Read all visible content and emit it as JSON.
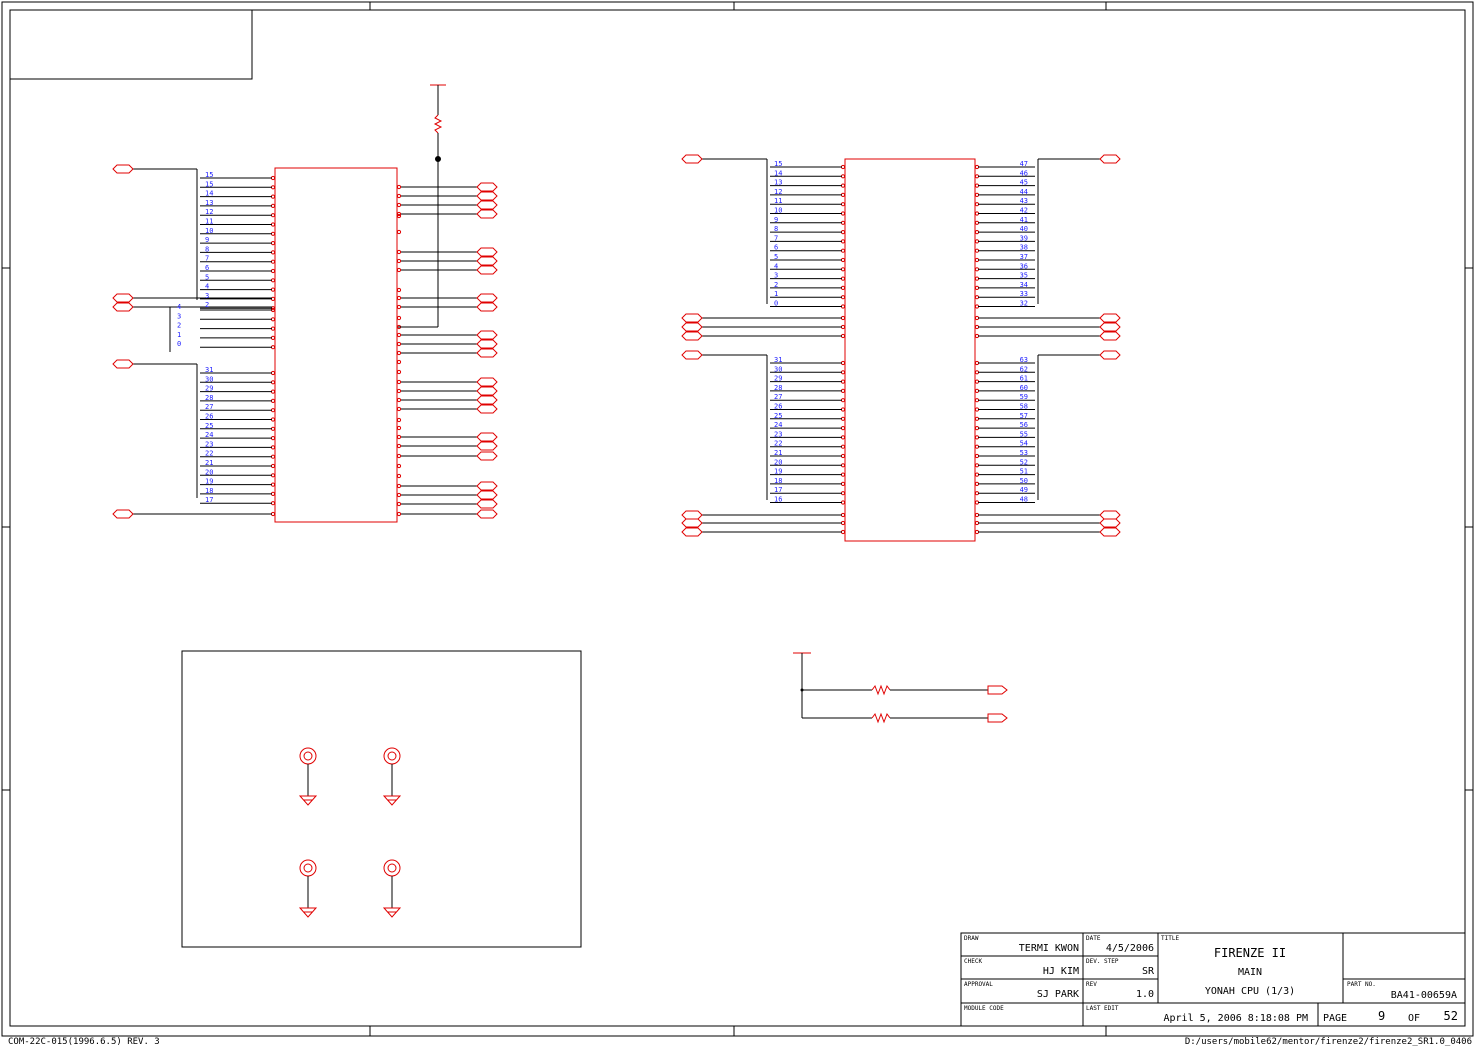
{
  "title_block": {
    "draw_label": "DRAW",
    "draw_value": "TERMI KWON",
    "check_label": "CHECK",
    "check_value": "HJ KIM",
    "approval_label": "APPROVAL",
    "approval_value": "SJ PARK",
    "module_label": "MODULE CODE",
    "date_label": "DATE",
    "date_value": "4/5/2006",
    "devstep_label": "DEV. STEP",
    "devstep_value": "SR",
    "rev_label": "REV",
    "rev_value": "1.0",
    "lastedit_label": "LAST EDIT",
    "lastedit_value": "April 5, 2006  8:18:08 PM",
    "title_label": "TITLE",
    "title_line1": "FIRENZE II",
    "title_line2": "MAIN",
    "title_line3": "YONAH CPU (1/3)",
    "partno_label": "PART NO.",
    "partno_value": "BA41-00659A",
    "page_label": "PAGE",
    "page_value": "9",
    "of_label": "OF",
    "page_total": "52"
  },
  "footer": {
    "form_code": "COM-22C-015(1996.6.5) REV. 3",
    "file_path": "D:/users/mobile62/mentor/firenze2/firenze2_SR1.0_0406"
  },
  "pins": {
    "u1_top": [
      "15",
      "15",
      "14",
      "13",
      "12",
      "11",
      "10",
      "9",
      "8",
      "7",
      "6",
      "5",
      "4",
      "3",
      "2"
    ],
    "u1_mid": [
      "4",
      "3",
      "2",
      "1",
      "0"
    ],
    "u1_bot": [
      "31",
      "30",
      "29",
      "28",
      "27",
      "26",
      "25",
      "24",
      "23",
      "22",
      "21",
      "20",
      "19",
      "18",
      "17"
    ],
    "u2_left_top": [
      "15",
      "14",
      "13",
      "12",
      "11",
      "10",
      "9",
      "8",
      "7",
      "6",
      "5",
      "4",
      "3",
      "2",
      "1",
      "0"
    ],
    "u2_right_top": [
      "47",
      "46",
      "45",
      "44",
      "43",
      "42",
      "41",
      "40",
      "39",
      "38",
      "37",
      "36",
      "35",
      "34",
      "33",
      "32"
    ],
    "u2_left_bot": [
      "31",
      "30",
      "29",
      "28",
      "27",
      "26",
      "25",
      "24",
      "23",
      "22",
      "21",
      "20",
      "19",
      "18",
      "17",
      "16"
    ],
    "u2_right_bot": [
      "63",
      "62",
      "61",
      "60",
      "59",
      "58",
      "57",
      "56",
      "55",
      "54",
      "53",
      "52",
      "51",
      "50",
      "49",
      "48"
    ]
  }
}
